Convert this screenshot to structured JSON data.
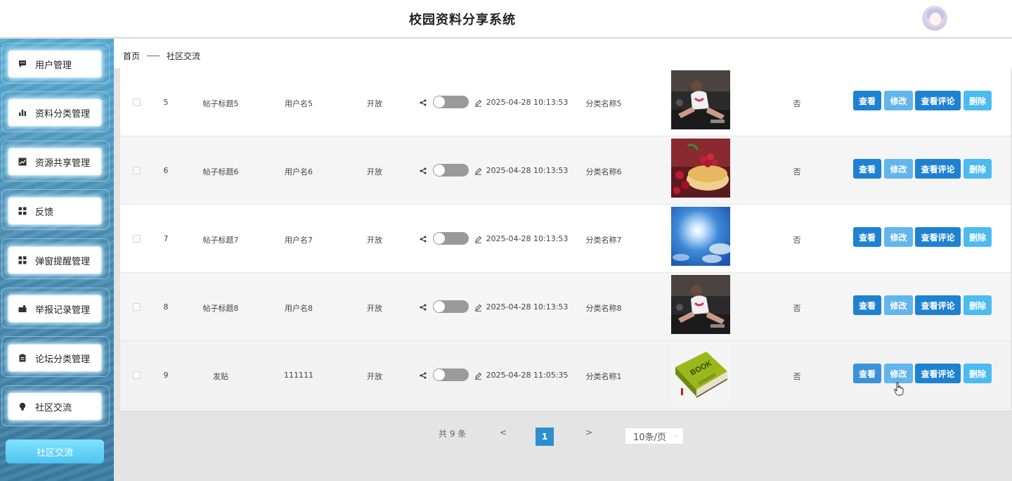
{
  "header": {
    "title": "校园资料分享系统"
  },
  "sidebar": {
    "items": [
      {
        "label": "用户管理",
        "icon": "chat-icon"
      },
      {
        "label": "资料分类管理",
        "icon": "bar-chart-icon"
      },
      {
        "label": "资源共享管理",
        "icon": "line-chart-icon"
      },
      {
        "label": "反馈",
        "icon": "grid-icon"
      },
      {
        "label": "弹窗提醒管理",
        "icon": "grid-icon"
      },
      {
        "label": "举报记录管理",
        "icon": "briefcase-icon"
      },
      {
        "label": "论坛分类管理",
        "icon": "clipboard-icon"
      },
      {
        "label": "社区交流",
        "icon": "bulb-icon"
      }
    ],
    "bottom_button": "社区交流"
  },
  "breadcrumb": {
    "home": "首页",
    "current": "社区交流"
  },
  "table": {
    "rows": [
      {
        "id": "5",
        "title": "帖子标题5",
        "user": "用户名5",
        "status": "开放",
        "time": "2025-04-28 10:13:53",
        "category": "分类名称5",
        "image": "woman-yoga-photo",
        "flag": "否"
      },
      {
        "id": "6",
        "title": "帖子标题6",
        "user": "用户名6",
        "status": "开放",
        "time": "2025-04-28 10:13:53",
        "category": "分类名称6",
        "image": "raspberry-cake-photo",
        "flag": "否"
      },
      {
        "id": "7",
        "title": "帖子标题7",
        "user": "用户名7",
        "status": "开放",
        "time": "2025-04-28 10:13:53",
        "category": "分类名称7",
        "image": "sun-sky-photo",
        "flag": "否"
      },
      {
        "id": "8",
        "title": "帖子标题8",
        "user": "用户名8",
        "status": "开放",
        "time": "2025-04-28 10:13:53",
        "category": "分类名称8",
        "image": "woman-yoga-photo",
        "flag": "否"
      },
      {
        "id": "9",
        "title": "发贴",
        "user": "111111",
        "status": "开放",
        "time": "2025-04-28 11:05:35",
        "category": "分类名称1",
        "image": "book-photo",
        "flag": "否"
      }
    ],
    "actions": {
      "view": "查看",
      "edit": "修改",
      "comments": "查看评论",
      "delete": "删除"
    }
  },
  "pagination": {
    "total": "共 9 条",
    "prev": "<",
    "current": "1",
    "next": ">",
    "page_size": "10条/页"
  },
  "colors": {
    "primary": "#1e82d2",
    "light": "#63b5ee",
    "delete": "#4cbbf0",
    "page": "#2d8fce"
  }
}
